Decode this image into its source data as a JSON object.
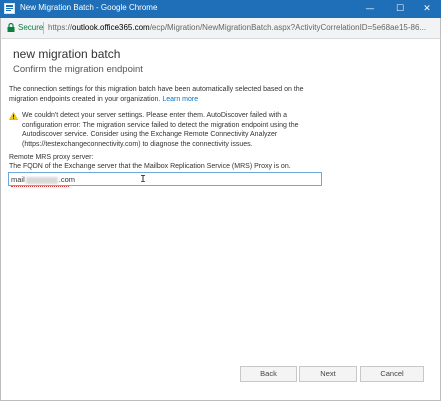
{
  "window": {
    "title": "New Migration Batch - Google Chrome",
    "minimize_glyph": "—",
    "maximize_glyph": "☐",
    "close_glyph": "✕"
  },
  "address": {
    "secure_label": "Secure",
    "url_scheme": "https://",
    "url_host": "outlook.office365.com",
    "url_path": "/ecp/Migration/NewMigrationBatch.aspx?ActivityCorrelationID=5e68ae15-86..."
  },
  "page": {
    "title": "new migration batch",
    "subtitle": "Confirm the migration endpoint",
    "intro_text": "The connection settings for this migration batch have been automatically selected based on the migration endpoints created in your organization.",
    "learn_more": "Learn more",
    "warning_text": "We couldn't detect your server settings. Please enter them. AutoDiscover failed with a configuration error: The migration service failed to detect the migration endpoint using the Autodiscover service. Consider using the Exchange Remote Connectivity Analyzer (https://testexchangeconnectivity.com) to diagnose the connectivity issues.",
    "field_label": "Remote MRS proxy server:",
    "field_help": "The FQDN of the Exchange server that the Mailbox Replication Service (MRS) Proxy is on.",
    "field_value_prefix": "mail",
    "field_value_suffix": ".com"
  },
  "buttons": {
    "back": "Back",
    "next": "Next",
    "cancel": "Cancel"
  },
  "colors": {
    "titlebar": "#1f6fb8",
    "link": "#0072c6",
    "secure": "#0b8043",
    "warning": "#f2c811"
  }
}
